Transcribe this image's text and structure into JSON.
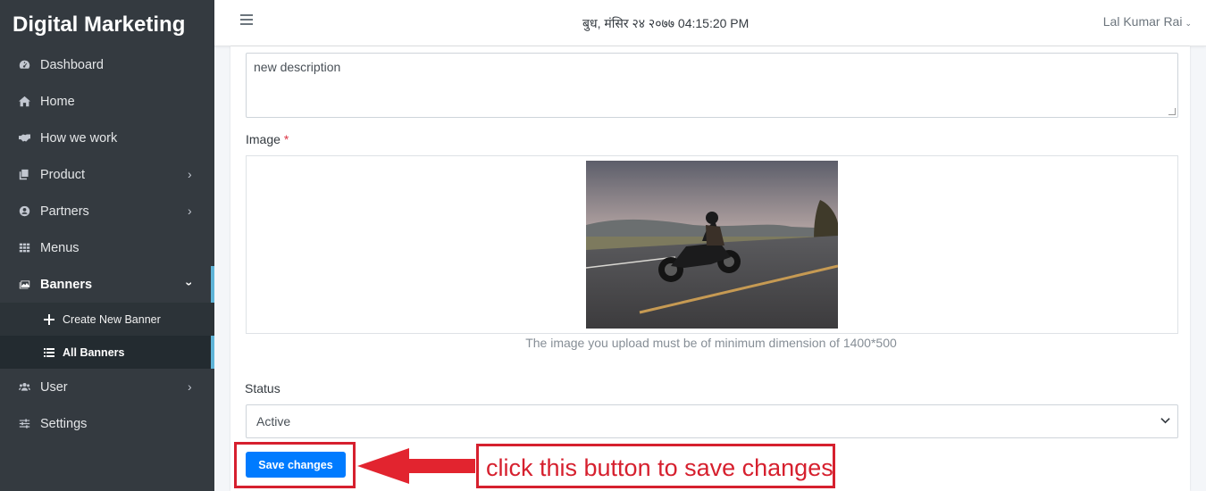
{
  "sidebar": {
    "brand": "Digital Marketing",
    "items": [
      {
        "label": "Dashboard",
        "icon": "tachometer-icon"
      },
      {
        "label": "Home",
        "icon": "home-icon"
      },
      {
        "label": "How we work",
        "icon": "handshake-icon"
      },
      {
        "label": "Product",
        "icon": "copy-icon",
        "has_submenu": true
      },
      {
        "label": "Partners",
        "icon": "user-circle-icon",
        "has_submenu": true
      },
      {
        "label": "Menus",
        "icon": "grid-icon"
      },
      {
        "label": "Banners",
        "icon": "images-icon",
        "expanded": true,
        "active": true
      },
      {
        "label": "User",
        "icon": "users-icon",
        "has_submenu": true
      },
      {
        "label": "Settings",
        "icon": "sliders-icon"
      }
    ],
    "banner_submenu": [
      {
        "label": "Create New Banner",
        "icon": "plus-icon"
      },
      {
        "label": "All Banners",
        "icon": "list-icon",
        "current": true
      }
    ]
  },
  "header": {
    "date": "बुध, मंसिर २४ २०७७  04:15:20 PM",
    "user": "Lal Kumar Rai"
  },
  "form": {
    "description_value": "new description",
    "image_label": "Image",
    "required_mark": "*",
    "image_hint": "The image you upload must be of minimum dimension of 1400*500",
    "status_label": "Status",
    "status_value": "Active",
    "save_label": "Save changes"
  },
  "annotation": {
    "text": "click this button to save changes",
    "color": "#d6202e"
  },
  "colors": {
    "sidebar_bg": "#343a40",
    "accent": "#5fb4d8",
    "primary": "#007bff"
  }
}
